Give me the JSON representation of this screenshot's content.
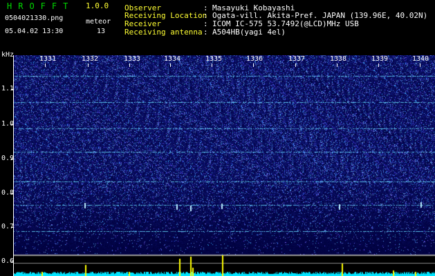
{
  "header": {
    "brand": "HROFFT",
    "version": "1.0.0",
    "filename": "0504021330.png",
    "datetime": "05.04.02 13:30",
    "counter_label": "meteor",
    "counter_value": "13",
    "fields": [
      {
        "label": "Observer",
        "value": "Masayuki Kobayashi"
      },
      {
        "label": "Receiving Location",
        "value": "Ogata-vill. Akita-Pref. JAPAN (139.96E, 40.02N)"
      },
      {
        "label": "Receiver",
        "value": "ICOM IC-575 53.7492(@LCD)MHz USB"
      },
      {
        "label": "Receiving antenna",
        "value": "A504HB(yagi 4el)"
      }
    ]
  },
  "spectrogram": {
    "y_axis_label": "kHz",
    "y_ticks": [
      "1.1",
      "1.0",
      "0.9",
      "0.8",
      "0.7",
      "0.6"
    ],
    "x_ticks": [
      "1331",
      "1332",
      "1333",
      "1334",
      "1335",
      "1336",
      "1337",
      "1338",
      "1339",
      "1340"
    ],
    "background_color": "#0a0a6e",
    "noise_color": "#3b55ff",
    "line_color": "#66ddff",
    "bar_color": "#ffff00",
    "baseline_color": "#00e5ff"
  }
}
